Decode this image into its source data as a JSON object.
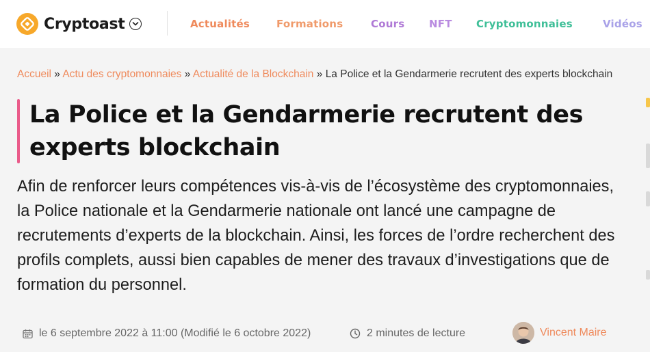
{
  "brand": {
    "name": "Cryptoast",
    "accent": "#f7a82a"
  },
  "nav": [
    {
      "label": "Actualités",
      "color": "#ef8a5c"
    },
    {
      "label": "Formations",
      "color": "#f09a6a"
    },
    {
      "label": "Cours",
      "color": "#b07ad6"
    },
    {
      "label": "NFT",
      "color": "#b98be0"
    },
    {
      "label": "Cryptomonnaies",
      "color": "#3fbf98"
    },
    {
      "label": "Vidéos",
      "color": "#a9a2e8"
    }
  ],
  "breadcrumb": {
    "items": [
      "Accueil",
      "Actu des cryptomonnaies",
      "Actualité de la Blockchain"
    ],
    "separator": "»",
    "current": "La Police et la Gendarmerie recrutent des experts blockchain"
  },
  "article": {
    "title": "La Police et la Gendarmerie recrutent des experts blockchain",
    "lead": "Afin de renforcer leurs compétences vis-à-vis de l’écosystème des cryptomonnaies, la Police nationale et la Gendarmerie nationale ont lancé une campagne de recrutements d’experts de la blockchain. Ainsi, les forces de l’ordre recherchent des profils complets, aussi bien capables de mener des travaux d’investigations que de formation du personnel.",
    "date": "le 6 septembre 2022 à 11:00 (Modifié le 6 octobre 2022)",
    "reading_time": "2 minutes de lecture",
    "author": "Vincent Maire"
  },
  "icons": {
    "calendar": "calendar-icon",
    "clock": "clock-icon",
    "chevron": "chevron-down-icon",
    "logo": "cryptoast-logo-icon"
  }
}
